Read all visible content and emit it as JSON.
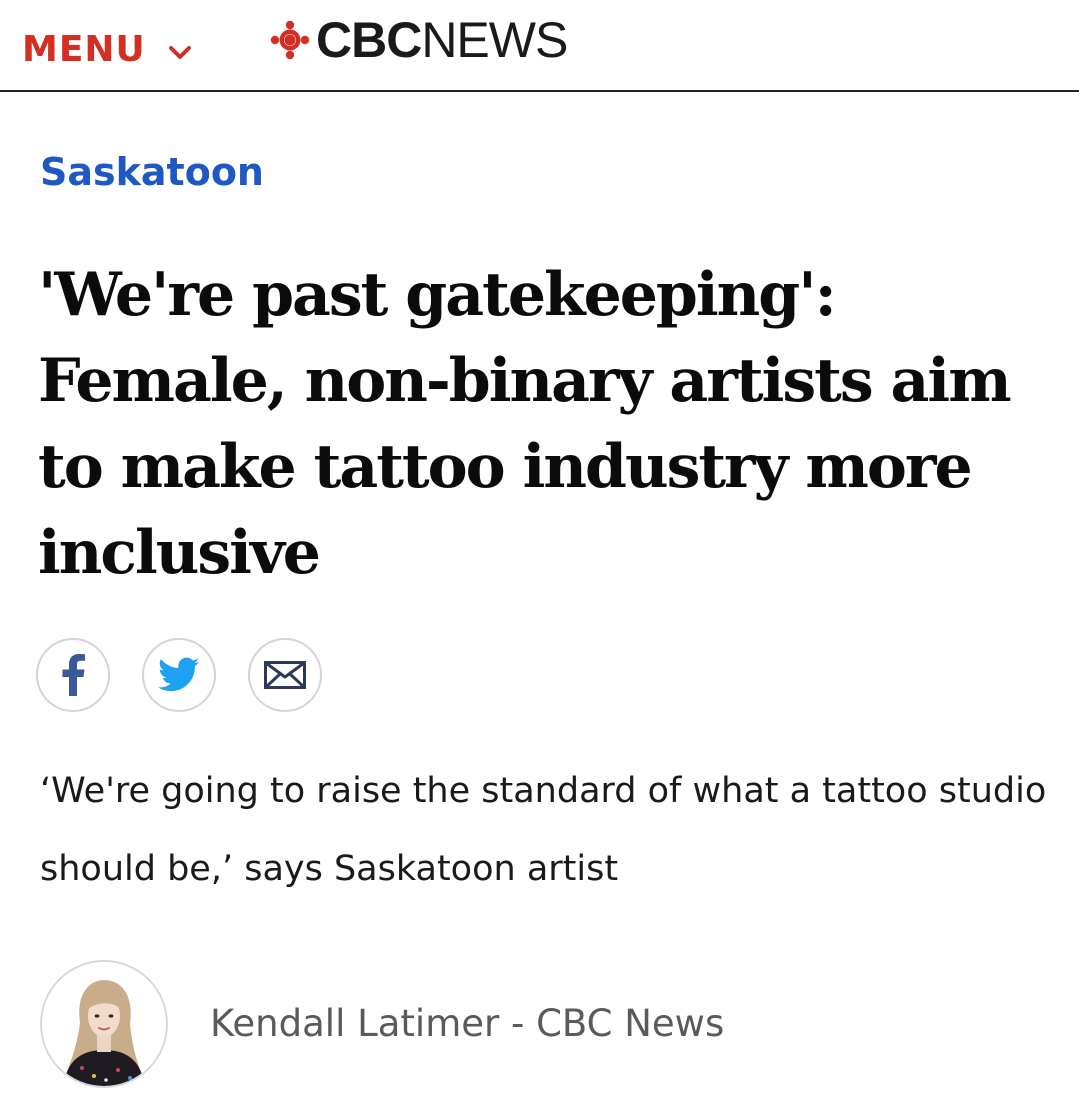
{
  "header": {
    "menu_label": "MENU",
    "logo_bold": "CBC",
    "logo_light": "NEWS",
    "brand_color": "#d32f22"
  },
  "article": {
    "section": "Saskatoon",
    "headline": "'We're past gatekeeping': Female, non-binary artists aim to make tattoo industry more inclusive",
    "deck": "‘We're going to raise the standard of what a tattoo studio should be,’ says Saskatoon artist",
    "byline": "Kendall Latimer - CBC News"
  },
  "share": {
    "icons": [
      "facebook-icon",
      "twitter-icon",
      "email-icon"
    ],
    "facebook_color": "#3b5998",
    "twitter_color": "#1da1f2",
    "email_color": "#2d3a55"
  },
  "colors": {
    "section_link": "#1f57c3",
    "divider": "#222222"
  }
}
